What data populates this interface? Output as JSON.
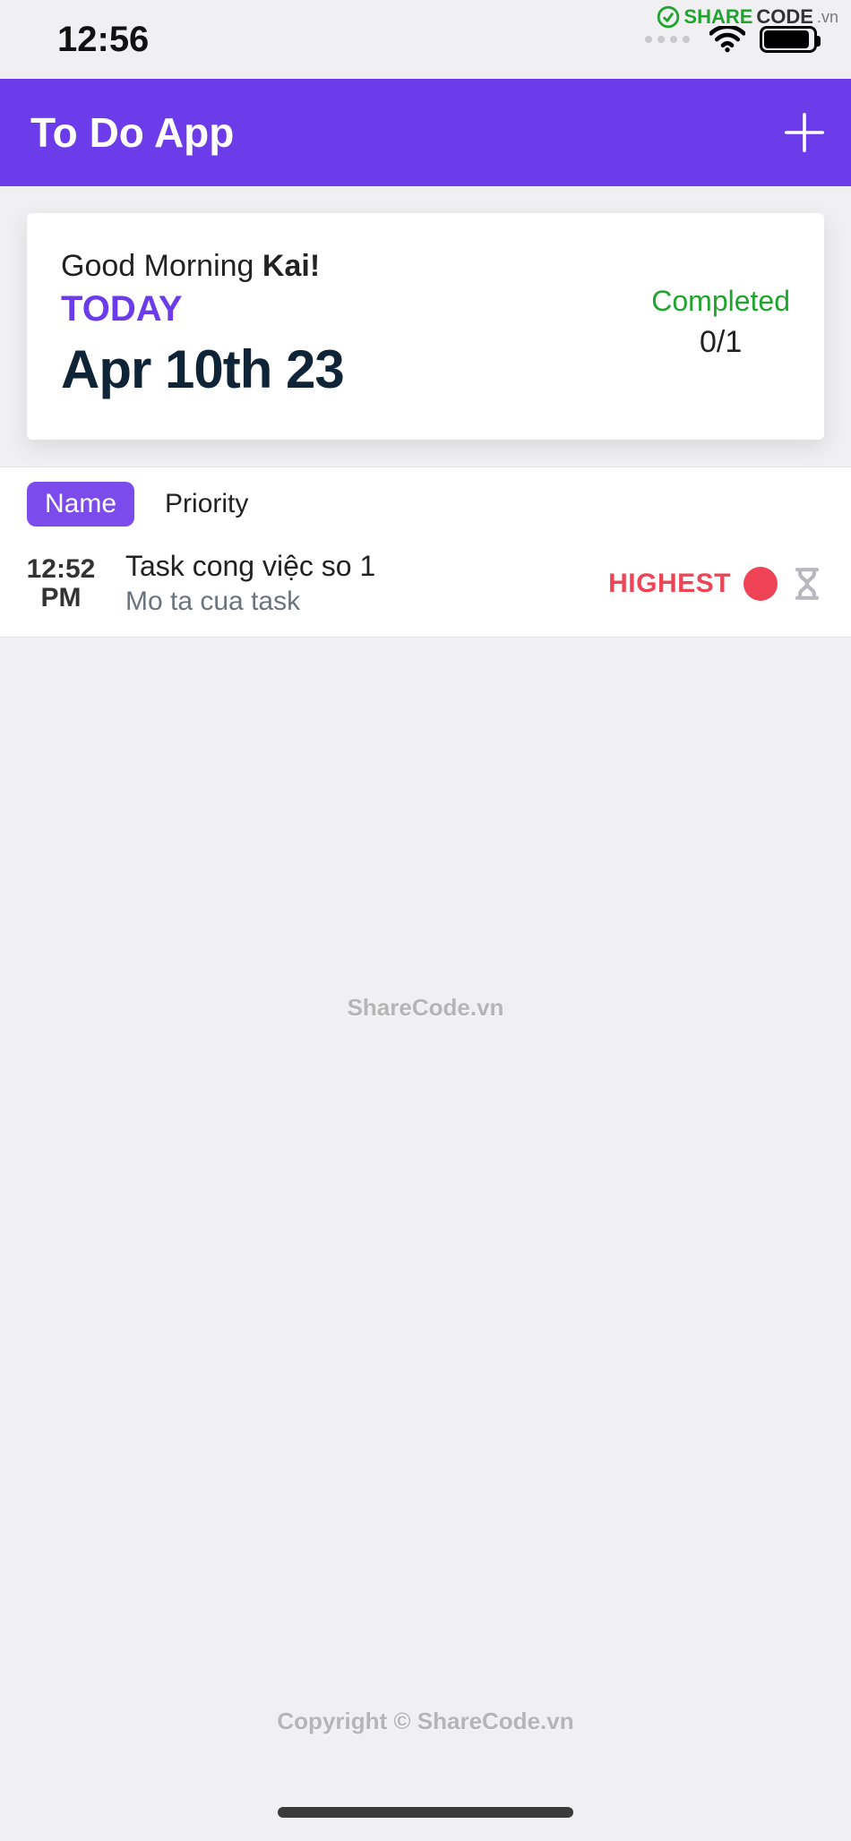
{
  "statusbar": {
    "time": "12:56"
  },
  "watermark": {
    "share": "SHARE",
    "code": "CODE",
    "vn": ".vn",
    "mid": "ShareCode.vn",
    "bot": "Copyright © ShareCode.vn"
  },
  "appbar": {
    "title": "To Do App"
  },
  "summary": {
    "greeting_prefix": "Good Morning ",
    "user_name": "Kai!",
    "today_label": "TODAY",
    "today_date": "Apr 10th 23",
    "completed_label": "Completed",
    "completed_count": "0/1"
  },
  "sort": {
    "name": "Name",
    "priority": "Priority",
    "active": "name"
  },
  "tasks": [
    {
      "time_hhmm": "12:52",
      "time_ampm": "PM",
      "title": "Task cong việc so 1",
      "desc": "Mo ta cua task",
      "priority_label": "HIGHEST",
      "priority_color": "#ee4456"
    }
  ]
}
